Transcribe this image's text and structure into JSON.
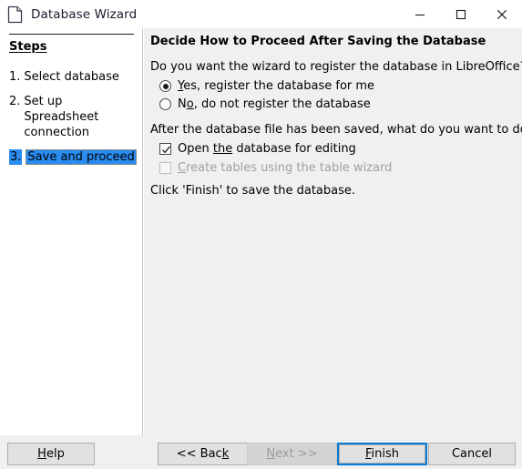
{
  "window": {
    "title": "Database Wizard",
    "icon": "document-icon",
    "controls": {
      "minimize": "minimize-icon",
      "maximize": "maximize-icon",
      "close": "close-icon"
    }
  },
  "sidebar": {
    "heading": "Steps",
    "items": [
      {
        "num": "1.",
        "label": "Select database",
        "active": false
      },
      {
        "num": "2.",
        "label": "Set up Spreadsheet connection",
        "active": false
      },
      {
        "num": "3.",
        "label": "Save and proceed",
        "active": true
      }
    ]
  },
  "content": {
    "title": "Decide How to Proceed After Saving the Database",
    "question_register": "Do you want the wizard to register the database in LibreOffice?",
    "radio_yes_pre": "Y",
    "radio_yes_post": "es, register the database for me",
    "radio_no_pre": "N",
    "radio_no_mn": "o",
    "radio_no_post": ", do not register the database",
    "question_after_save": "After the database file has been saved, what do you want to do?",
    "check_open_pre": "Open ",
    "check_open_mn": "the",
    "check_open_post": " database for editing",
    "check_tables_mn": "C",
    "check_tables_post": "reate tables using the table wizard",
    "finish_hint": "Click 'Finish' to save the database."
  },
  "buttons": {
    "help_mn": "H",
    "help_post": "elp",
    "back_pre": "<< Bac",
    "back_mn": "k",
    "next_mn": "N",
    "next_post": "ext >>",
    "finish_mn": "F",
    "finish_post": "inish",
    "cancel": "Cancel"
  },
  "colors": {
    "accent": "#0a7bd4",
    "highlight": "#2a8cf0",
    "focus_outline": "#d08b2e",
    "panel": "#f0f0f0",
    "button_face": "#e1e1e1",
    "disabled_text": "#a0a0a0"
  }
}
